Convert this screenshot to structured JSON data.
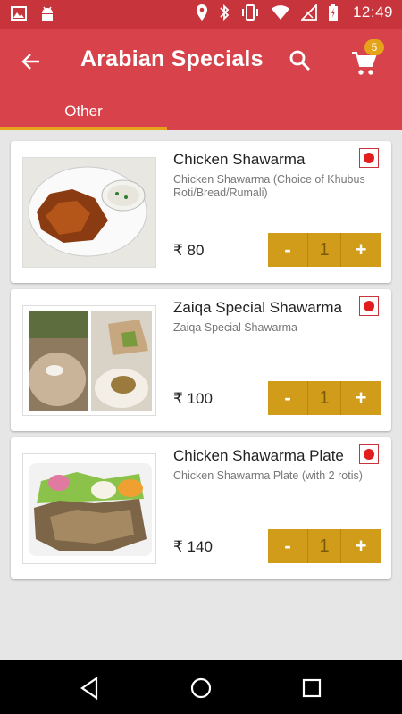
{
  "status_bar": {
    "time": "12:49"
  },
  "app_bar": {
    "title": "Arabian Specials",
    "cart_count": "5"
  },
  "tabs": [
    {
      "label": "Other"
    }
  ],
  "products": [
    {
      "name": "Chicken Shawarma",
      "description": "Chicken Shawarma  (Choice of Khubus Roti/Bread/Rumali)",
      "price": "₹ 80",
      "quantity": "1",
      "minus": "-",
      "plus": "+"
    },
    {
      "name": "Zaiqa Special Shawarma",
      "description": "Zaiqa Special Shawarma",
      "price": "₹ 100",
      "quantity": "1",
      "minus": "-",
      "plus": "+"
    },
    {
      "name": "Chicken Shawarma Plate",
      "description": "Chicken Shawarma Plate (with 2 rotis)",
      "price": "₹ 140",
      "quantity": "1",
      "minus": "-",
      "plus": "+"
    }
  ],
  "colors": {
    "primary": "#d8434b",
    "status": "#c8343c",
    "accent": "#e6a31a",
    "stepper": "#d19c1a"
  },
  "icons": {
    "back": "arrow-left-icon",
    "search": "search-icon",
    "cart": "cart-icon"
  }
}
